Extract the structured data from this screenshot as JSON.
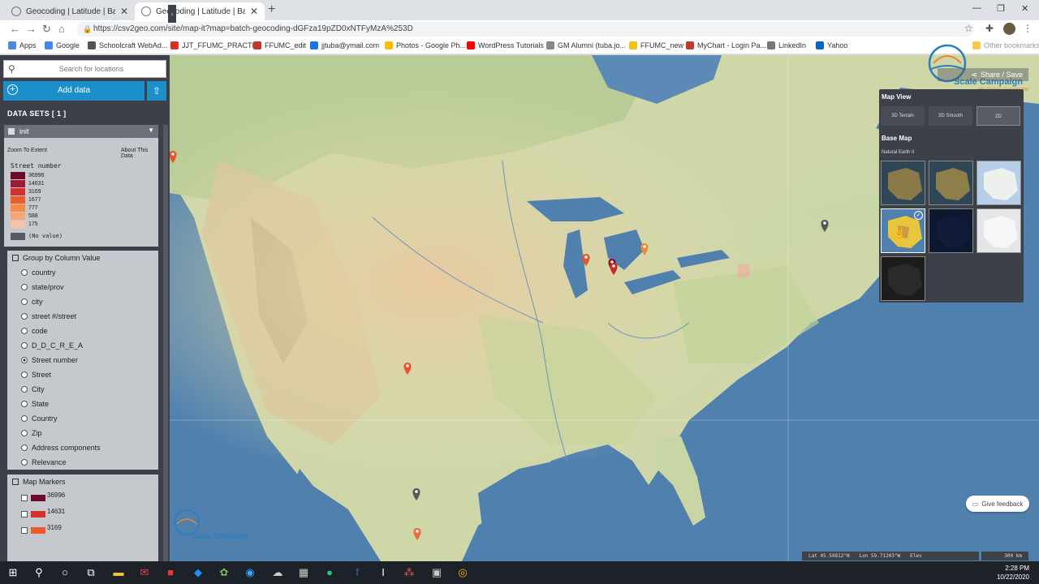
{
  "browser": {
    "tabs": [
      {
        "title": "Geocoding | Latitude | Batch Geo"
      },
      {
        "title": "Geocoding | Latitude | Batch Geo"
      }
    ],
    "url": "https://csv2geo.com/site/map-it?map=batch-geocoding-dGFza19pZD0xNTFyMzA%253D",
    "bookmarks": [
      "Apps",
      "Google",
      "Schoolcraft WebAd...",
      "JJT_FFUMC_PRACTI...",
      "FFUMC_edit",
      "jjtuba@ymail.com",
      "Photos - Google Ph...",
      "WordPress Tutorials",
      "GM Alumni (tuba.jo...",
      "FFUMC_new",
      "MyChart - Login Pa...",
      "LinkedIn",
      "Yahoo",
      "Other bookmarks"
    ],
    "bookmark_colors": [
      "#4a89dc",
      "#4285f4",
      "#555555",
      "#d93025",
      "#c0392b",
      "#1a73e8",
      "#fbbc04",
      "#ff0000",
      "#888888",
      "#f4c20d",
      "#c0392b",
      "#777777",
      "#0a66c2",
      "#f6c94f",
      "#f6c94f"
    ]
  },
  "sidebar": {
    "search_placeholder": "Search for locations",
    "add_data": "Add data",
    "datasets_label": "DATA SETS",
    "datasets_count": "[ 1 ]",
    "layer_name": "init",
    "zoom_to_extent": "Zoom To Extent",
    "about_data": "About This Data",
    "legend_title": "Street number",
    "legend": [
      {
        "value": "36996",
        "color": "#6b0a2a"
      },
      {
        "value": "14631",
        "color": "#9e1a33"
      },
      {
        "value": "3169",
        "color": "#d4302d"
      },
      {
        "value": "1677",
        "color": "#ef5a2b"
      },
      {
        "value": "777",
        "color": "#f48b46"
      },
      {
        "value": "588",
        "color": "#f6a575"
      },
      {
        "value": "175",
        "color": "#f7c2a5"
      }
    ],
    "no_value": "(No value)",
    "no_value_color": "#555a62",
    "group_title": "Group by Column Value",
    "group_options": [
      "country",
      "state/prov",
      "city",
      "street #/street",
      "code",
      "D_D_C_R_E_A",
      "Street number",
      "Street",
      "City",
      "State",
      "Country",
      "Zip",
      "Address components",
      "Relevance"
    ],
    "group_selected": "Street number",
    "markers_title": "Map Markers",
    "markers": [
      {
        "value": "36996",
        "color": "#6b0a2a"
      },
      {
        "value": "14631",
        "color": "#d4302d"
      },
      {
        "value": "3169",
        "color": "#ef5a2b"
      }
    ]
  },
  "map": {
    "share_save": "Share / Save",
    "logo_text": "Scale Campaign",
    "logo_sub": "We Deliver Sustainable",
    "feedback": "Give feedback",
    "lat": "Lat 45.59812°N",
    "lon": "Lon 59.71203°W",
    "elev": "Elev",
    "scale": "300 km",
    "panel": {
      "title": "Map View",
      "view_buttons": [
        "3D Terrain",
        "3D Smooth",
        "2D"
      ],
      "view_selected": "2D",
      "base_map_title": "Base Map",
      "base_map_selected_name": "Natural Earth II"
    },
    "markers": [
      {
        "color": "#e8542a"
      },
      {
        "color": "#e8542a"
      },
      {
        "color": "#8b1020"
      },
      {
        "color": "#c82a2a"
      },
      {
        "color": "#f08a3a"
      },
      {
        "color": "#555a55"
      },
      {
        "color": "#e8542a"
      },
      {
        "color": "#555a55"
      },
      {
        "color": "#ef6a3a"
      }
    ]
  },
  "taskbar": {
    "time": "2:28 PM",
    "date": "10/22/2020"
  }
}
